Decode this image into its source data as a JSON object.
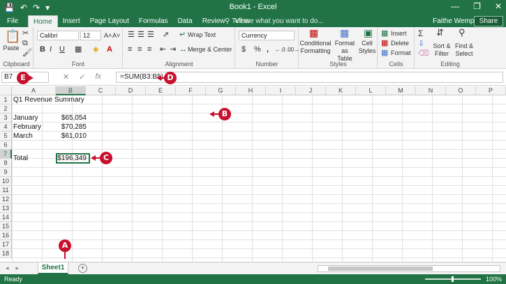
{
  "titlebar": {
    "title": "Book1 - Excel",
    "save_icon": "💾",
    "undo_icon": "↶",
    "redo_icon": "↷",
    "customize_icon": "▾",
    "min_icon": "—",
    "restore_icon": "❐",
    "close_icon": "✕"
  },
  "tabs": {
    "file": "File",
    "items": [
      "Home",
      "Insert",
      "Page Layout",
      "Formulas",
      "Data",
      "Review",
      "View"
    ],
    "tell_me": "Tell me what you want to do...",
    "user": "Faithe Wemp...",
    "share": "Share"
  },
  "ribbon": {
    "clipboard": {
      "label": "Clipboard",
      "paste": "Paste"
    },
    "font": {
      "label": "Font",
      "font_name": "Calibri",
      "font_size": "12",
      "bold": "B",
      "italic": "I",
      "underline": "U"
    },
    "alignment": {
      "label": "Alignment",
      "wrap_text": "Wrap Text",
      "merge_center": "Merge & Center"
    },
    "number": {
      "label": "Number",
      "format": "Currency",
      "dollar": "$",
      "percent": "%",
      "comma": ","
    },
    "styles": {
      "label": "Styles",
      "conditional": "Conditional",
      "formatting": "Formatting",
      "format_as": "Format as",
      "table": "Table",
      "cell": "Cell",
      "cell_styles": "Styles"
    },
    "cells": {
      "label": "Cells",
      "insert": "Insert",
      "delete": "Delete",
      "format": "Format"
    },
    "editing": {
      "label": "Editing",
      "sort": "Sort &",
      "filter": "Filter",
      "find": "Find &",
      "select": "Select"
    }
  },
  "formula_bar": {
    "name_box": "B7",
    "cancel_icon": "✕",
    "enter_icon": "✓",
    "fx": "fx",
    "formula": "=SUM(B3:B5)"
  },
  "columns": [
    "A",
    "B",
    "C",
    "D",
    "E",
    "F",
    "G",
    "H",
    "I",
    "J",
    "K",
    "L",
    "M",
    "N",
    "O",
    "P"
  ],
  "rows": [
    "1",
    "2",
    "3",
    "4",
    "5",
    "6",
    "7",
    "8",
    "9",
    "10",
    "11",
    "12",
    "13",
    "14",
    "15",
    "16",
    "17",
    "18"
  ],
  "cells": {
    "a1": "Q1 Revenue Summary",
    "a3": "January",
    "b3": "$65,054",
    "a4": "February",
    "b4": "$70,285",
    "a5": "March",
    "b5": "$61,010",
    "a7": "Total",
    "b7": "$196,349"
  },
  "callouts": {
    "a": "A",
    "b": "B",
    "c": "C",
    "d": "D",
    "e": "E"
  },
  "sheets": {
    "active": "Sheet1",
    "add_icon": "+",
    "prev_icon": "◂",
    "next_icon": "▸"
  },
  "status": {
    "ready": "Ready",
    "zoom": "100%"
  },
  "colors": {
    "accent": "#217346",
    "callout": "#c8102e"
  }
}
